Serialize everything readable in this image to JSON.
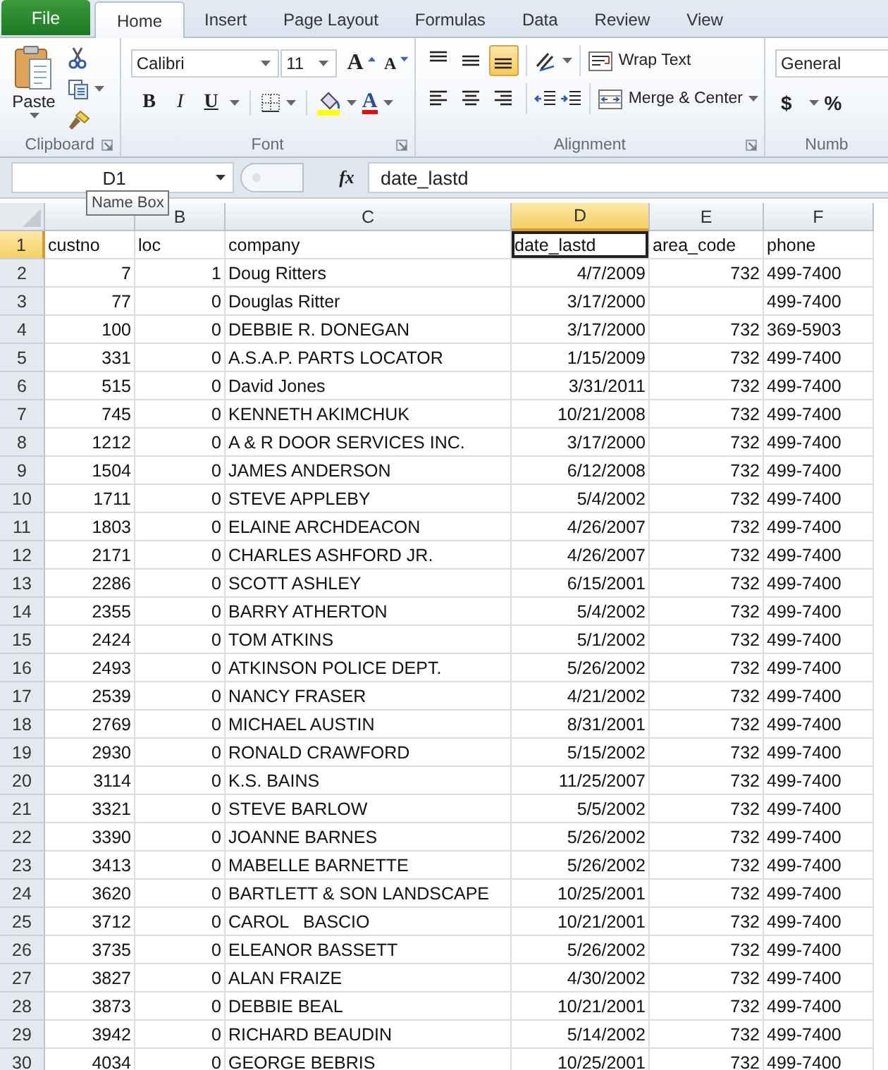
{
  "ribbon_tabs": [
    {
      "label": "File",
      "kind": "file",
      "selected": false
    },
    {
      "label": "Home",
      "kind": "tab",
      "selected": true
    },
    {
      "label": "Insert",
      "kind": "tab",
      "selected": false
    },
    {
      "label": "Page Layout",
      "kind": "tab",
      "selected": false
    },
    {
      "label": "Formulas",
      "kind": "tab",
      "selected": false
    },
    {
      "label": "Data",
      "kind": "tab",
      "selected": false
    },
    {
      "label": "Review",
      "kind": "tab",
      "selected": false
    },
    {
      "label": "View",
      "kind": "tab",
      "selected": false
    }
  ],
  "clipboard": {
    "paste_label": "Paste",
    "group_label": "Clipboard"
  },
  "font": {
    "name": "Calibri",
    "size": "11",
    "grow": "A",
    "shrink": "A",
    "bold": "B",
    "italic": "I",
    "underline": "U",
    "font_color": "A",
    "group_label": "Font"
  },
  "alignment": {
    "vertical": [
      {
        "kind": "top",
        "selected": false
      },
      {
        "kind": "middle",
        "selected": false
      },
      {
        "kind": "bottom",
        "selected": true
      }
    ],
    "horizontal": [
      {
        "kind": "left",
        "selected": false
      },
      {
        "kind": "center",
        "selected": false
      },
      {
        "kind": "right",
        "selected": false
      }
    ],
    "wrap_text": "Wrap Text",
    "merge_center": "Merge & Center",
    "group_label": "Alignment"
  },
  "number": {
    "format": "General",
    "currency": "$",
    "percent": "%",
    "group_label": "Numb"
  },
  "formula_bar": {
    "name_box": "D1",
    "function_label": "fx",
    "formula": "date_lastd"
  },
  "tooltip": "Name Box",
  "columns": [
    {
      "selected": false,
      "numeric": true
    },
    {
      "label": "B",
      "selected": false,
      "numeric": true
    },
    {
      "label": "C",
      "selected": false,
      "numeric": false
    },
    {
      "label": "D",
      "selected": true,
      "numeric": true
    },
    {
      "label": "E",
      "selected": false,
      "numeric": true
    },
    {
      "label": "F",
      "selected": false,
      "numeric": false
    }
  ],
  "rows": [
    {
      "number": "1",
      "selected": true,
      "kind": "header",
      "cells": [
        "custno",
        "loc",
        "company",
        "date_lastd",
        "area_code",
        "phone"
      ]
    },
    {
      "number": "2",
      "selected": false,
      "kind": "data",
      "cells": [
        "7",
        "1",
        "Doug Ritters",
        "4/7/2009",
        "732",
        "499-7400"
      ]
    },
    {
      "number": "3",
      "selected": false,
      "kind": "data",
      "cells": [
        "77",
        "0",
        "Douglas Ritter",
        "3/17/2000",
        "",
        "499-7400"
      ]
    },
    {
      "number": "4",
      "selected": false,
      "kind": "data",
      "cells": [
        "100",
        "0",
        "DEBBIE R. DONEGAN",
        "3/17/2000",
        "732",
        "369-5903"
      ]
    },
    {
      "number": "5",
      "selected": false,
      "kind": "data",
      "cells": [
        "331",
        "0",
        "A.S.A.P. PARTS LOCATOR",
        "1/15/2009",
        "732",
        "499-7400"
      ]
    },
    {
      "number": "6",
      "selected": false,
      "kind": "data",
      "cells": [
        "515",
        "0",
        "David Jones",
        "3/31/2011",
        "732",
        "499-7400"
      ]
    },
    {
      "number": "7",
      "selected": false,
      "kind": "data",
      "cells": [
        "745",
        "0",
        "KENNETH AKIMCHUK",
        "10/21/2008",
        "732",
        "499-7400"
      ]
    },
    {
      "number": "8",
      "selected": false,
      "kind": "data",
      "cells": [
        "1212",
        "0",
        "A & R DOOR SERVICES INC.",
        "3/17/2000",
        "732",
        "499-7400"
      ]
    },
    {
      "number": "9",
      "selected": false,
      "kind": "data",
      "cells": [
        "1504",
        "0",
        "JAMES ANDERSON",
        "6/12/2008",
        "732",
        "499-7400"
      ]
    },
    {
      "number": "10",
      "selected": false,
      "kind": "data",
      "cells": [
        "1711",
        "0",
        "STEVE APPLEBY",
        "5/4/2002",
        "732",
        "499-7400"
      ]
    },
    {
      "number": "11",
      "selected": false,
      "kind": "data",
      "cells": [
        "1803",
        "0",
        "ELAINE ARCHDEACON",
        "4/26/2007",
        "732",
        "499-7400"
      ]
    },
    {
      "number": "12",
      "selected": false,
      "kind": "data",
      "cells": [
        "2171",
        "0",
        "CHARLES ASHFORD JR.",
        "4/26/2007",
        "732",
        "499-7400"
      ]
    },
    {
      "number": "13",
      "selected": false,
      "kind": "data",
      "cells": [
        "2286",
        "0",
        "SCOTT ASHLEY",
        "6/15/2001",
        "732",
        "499-7400"
      ]
    },
    {
      "number": "14",
      "selected": false,
      "kind": "data",
      "cells": [
        "2355",
        "0",
        "BARRY ATHERTON",
        "5/4/2002",
        "732",
        "499-7400"
      ]
    },
    {
      "number": "15",
      "selected": false,
      "kind": "data",
      "cells": [
        "2424",
        "0",
        "TOM ATKINS",
        "5/1/2002",
        "732",
        "499-7400"
      ]
    },
    {
      "number": "16",
      "selected": false,
      "kind": "data",
      "cells": [
        "2493",
        "0",
        "ATKINSON POLICE DEPT.",
        "5/26/2002",
        "732",
        "499-7400"
      ]
    },
    {
      "number": "17",
      "selected": false,
      "kind": "data",
      "cells": [
        "2539",
        "0",
        "NANCY FRASER",
        "4/21/2002",
        "732",
        "499-7400"
      ]
    },
    {
      "number": "18",
      "selected": false,
      "kind": "data",
      "cells": [
        "2769",
        "0",
        "MICHAEL AUSTIN",
        "8/31/2001",
        "732",
        "499-7400"
      ]
    },
    {
      "number": "19",
      "selected": false,
      "kind": "data",
      "cells": [
        "2930",
        "0",
        "RONALD CRAWFORD",
        "5/15/2002",
        "732",
        "499-7400"
      ]
    },
    {
      "number": "20",
      "selected": false,
      "kind": "data",
      "cells": [
        "3114",
        "0",
        "K.S. BAINS",
        "11/25/2007",
        "732",
        "499-7400"
      ]
    },
    {
      "number": "21",
      "selected": false,
      "kind": "data",
      "cells": [
        "3321",
        "0",
        "STEVE BARLOW",
        "5/5/2002",
        "732",
        "499-7400"
      ]
    },
    {
      "number": "22",
      "selected": false,
      "kind": "data",
      "cells": [
        "3390",
        "0",
        "JOANNE BARNES",
        "5/26/2002",
        "732",
        "499-7400"
      ]
    },
    {
      "number": "23",
      "selected": false,
      "kind": "data",
      "cells": [
        "3413",
        "0",
        "MABELLE BARNETTE",
        "5/26/2002",
        "732",
        "499-7400"
      ]
    },
    {
      "number": "24",
      "selected": false,
      "kind": "data",
      "cells": [
        "3620",
        "0",
        "BARTLETT & SON LANDSCAPE",
        "10/25/2001",
        "732",
        "499-7400"
      ]
    },
    {
      "number": "25",
      "selected": false,
      "kind": "data",
      "cells": [
        "3712",
        "0",
        "CAROL   BASCIO",
        "10/21/2001",
        "732",
        "499-7400"
      ]
    },
    {
      "number": "26",
      "selected": false,
      "kind": "data",
      "cells": [
        "3735",
        "0",
        "ELEANOR BASSETT",
        "5/26/2002",
        "732",
        "499-7400"
      ]
    },
    {
      "number": "27",
      "selected": false,
      "kind": "data",
      "cells": [
        "3827",
        "0",
        "ALAN FRAIZE",
        "4/30/2002",
        "732",
        "499-7400"
      ]
    },
    {
      "number": "28",
      "selected": false,
      "kind": "data",
      "cells": [
        "3873",
        "0",
        "DEBBIE BEAL",
        "10/21/2001",
        "732",
        "499-7400"
      ]
    },
    {
      "number": "29",
      "selected": false,
      "kind": "data",
      "cells": [
        "3942",
        "0",
        "RICHARD BEAUDIN",
        "5/14/2002",
        "732",
        "499-7400"
      ]
    },
    {
      "number": "30",
      "selected": false,
      "kind": "data",
      "cells": [
        "4034",
        "0",
        "GEORGE BEBRIS",
        "10/25/2001",
        "732",
        "499-7400"
      ]
    }
  ]
}
